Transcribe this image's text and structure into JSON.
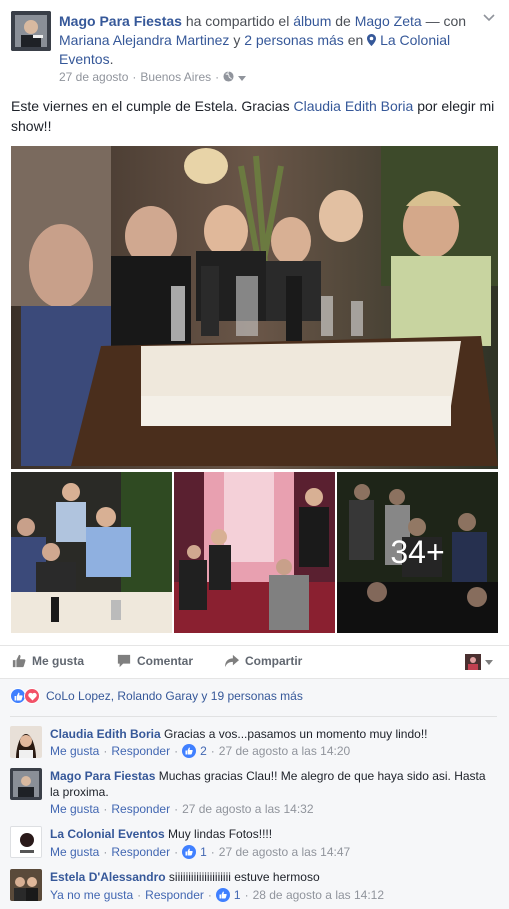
{
  "post": {
    "author": "Mago Para Fiestas",
    "shared_text": "ha compartido el",
    "album_word": "álbum",
    "of_text": "de",
    "album_owner": "Mago Zeta",
    "with_text": "— con",
    "tagged_person": "Mariana Alejandra Martinez",
    "and_text": "y",
    "others_tagged": "2 personas más",
    "in_text": "en",
    "place": "La Colonial Eventos",
    "period": ".",
    "date": "27 de agosto",
    "location": "Buenos Aires",
    "separator": "·",
    "body_before": "Este viernes en el cumple de Estela. Gracias",
    "body_mention": "Claudia Edith Boria",
    "body_after": "por elegir mi show!!",
    "more_photos": "34+"
  },
  "actions": {
    "like": "Me gusta",
    "comment": "Comentar",
    "share": "Compartir"
  },
  "reactions": {
    "summary": "CoLo Lopez, Rolando Garay y 19 personas más"
  },
  "comments": [
    {
      "author": "Claudia Edith Boria",
      "text": "Gracias a vos...pasamos un momento muy lindo!!",
      "like": "Me gusta",
      "reply": "Responder",
      "likes": "2",
      "time": "27 de agosto a las 14:20"
    },
    {
      "author": "Mago Para Fiestas",
      "text": "Muchas gracias Clau!! Me alegro de que haya sido asi. Hasta la proxima.",
      "like": "Me gusta",
      "reply": "Responder",
      "likes": "",
      "time": "27 de agosto a las 14:32"
    },
    {
      "author": "La Colonial Eventos",
      "text": "Muy lindas Fotos!!!!",
      "like": "Me gusta",
      "reply": "Responder",
      "likes": "1",
      "time": "27 de agosto a las 14:47"
    },
    {
      "author": "Estela D'Alessandro",
      "text": "siiiiiiiiiiiiiiiiiiiii estuve hermoso",
      "like": "Ya no me gusta",
      "reply": "Responder",
      "likes": "1",
      "time": "28 de agosto a las 14:12"
    }
  ],
  "colors": {
    "link": "#365899",
    "meta": "#90949c",
    "like_blue": "#4080ff",
    "love_red": "#f25268",
    "comments_bg": "#f6f7f9"
  },
  "icons": [
    "globe-icon",
    "chevron-down-icon",
    "location-pin-icon",
    "thumbs-up-icon",
    "comment-icon",
    "share-icon",
    "like-reaction-icon",
    "love-reaction-icon"
  ]
}
